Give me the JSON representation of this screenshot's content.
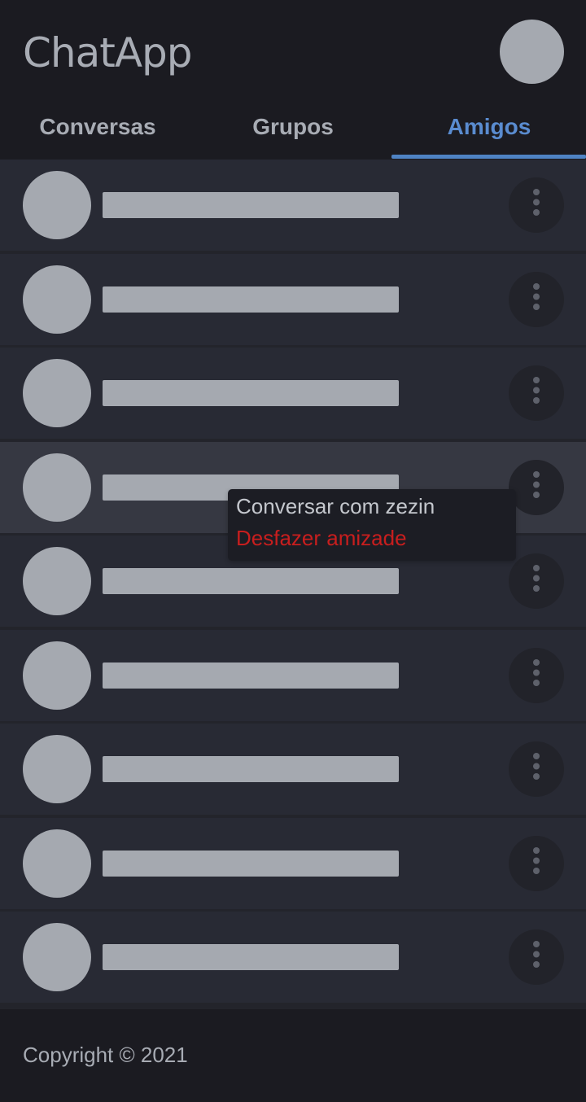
{
  "app": {
    "title": "ChatApp"
  },
  "tabs": [
    {
      "label": "Conversas",
      "active": false
    },
    {
      "label": "Grupos",
      "active": false
    },
    {
      "label": "Amigos",
      "active": true
    }
  ],
  "friends": {
    "highlighted_index": 3,
    "items": [
      {
        "name": "",
        "menu_icon": "more-vert-icon"
      },
      {
        "name": "",
        "menu_icon": "more-vert-icon"
      },
      {
        "name": "",
        "menu_icon": "more-vert-icon"
      },
      {
        "name": "",
        "menu_icon": "more-vert-icon"
      },
      {
        "name": "",
        "menu_icon": "more-vert-icon"
      },
      {
        "name": "",
        "menu_icon": "more-vert-icon"
      },
      {
        "name": "",
        "menu_icon": "more-vert-icon"
      },
      {
        "name": "",
        "menu_icon": "more-vert-icon"
      },
      {
        "name": "",
        "menu_icon": "more-vert-icon"
      }
    ]
  },
  "context_menu": {
    "chat_label": "Conversar com zezin",
    "unfriend_label": "Desfazer amizade"
  },
  "footer": {
    "copyright": "Copyright © 2021"
  },
  "colors": {
    "accent": "#5a8cd0",
    "danger": "#c81e1e",
    "background": "#1b1b21",
    "row": "#282a34",
    "row_highlight": "#363842",
    "placeholder": "#a5a9b0"
  }
}
